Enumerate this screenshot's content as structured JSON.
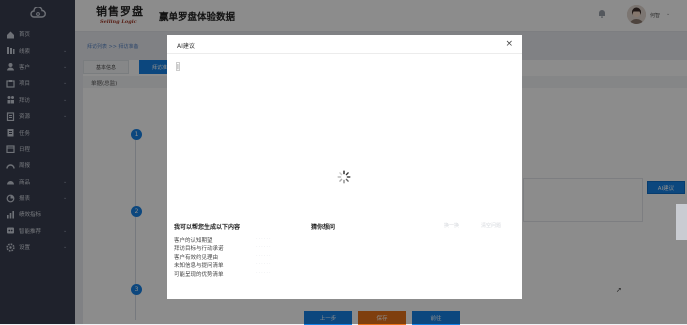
{
  "sidebar": {
    "items": [
      {
        "label": "首页",
        "icon": "home-icon",
        "chev": false
      },
      {
        "label": "线索",
        "icon": "leads-icon",
        "chev": true
      },
      {
        "label": "客户",
        "icon": "customer-icon",
        "chev": true
      },
      {
        "label": "项目",
        "icon": "project-icon",
        "chev": true
      },
      {
        "label": "拜访",
        "icon": "visit-icon",
        "chev": true
      },
      {
        "label": "资源",
        "icon": "resource-icon",
        "chev": true
      },
      {
        "label": "任务",
        "icon": "task-icon",
        "chev": false
      },
      {
        "label": "日程",
        "icon": "calendar-icon",
        "chev": false
      },
      {
        "label": "周报",
        "icon": "weekly-report-icon",
        "chev": false
      },
      {
        "label": "商品",
        "icon": "product-icon",
        "chev": true
      },
      {
        "label": "报表",
        "icon": "report-icon",
        "chev": true
      },
      {
        "label": "绩效指标",
        "icon": "kpi-icon",
        "chev": false
      },
      {
        "label": "智能推荐",
        "icon": "smart-recommend-icon",
        "chev": true
      },
      {
        "label": "设置",
        "icon": "settings-icon",
        "chev": true
      }
    ]
  },
  "header": {
    "brand_cn": "销售罗盘",
    "brand_en": "Selling Logic",
    "title": "赢单罗盘体验数据",
    "username": "何智"
  },
  "breadcrumb": "拜访列表 >> 拜访准备",
  "tabs": [
    "基本信息",
    "拜访准备"
  ],
  "section_label": "单据(总监)",
  "ai_button": "AI建议",
  "steps": [
    "1",
    "2",
    "3"
  ],
  "buttons": {
    "prev": "上一步",
    "save": "保存",
    "next": "前往"
  },
  "modal": {
    "title": "AI建议",
    "close": "×",
    "cursor_text": "|",
    "generate_heading": "我可以帮您生成以下内容",
    "guess_heading": "猜你想问",
    "faded_left": "换一换",
    "faded_right": "清空问题",
    "suggestions": [
      "客户的认知期望",
      "拜访目标与行动承诺",
      "客户有效约见理由",
      "未知信息与提问清单",
      "可能呈现的优势清单"
    ]
  },
  "colors": {
    "accent": "#1682e6",
    "save": "#e8731a",
    "sidebar": "#3a3f51"
  }
}
